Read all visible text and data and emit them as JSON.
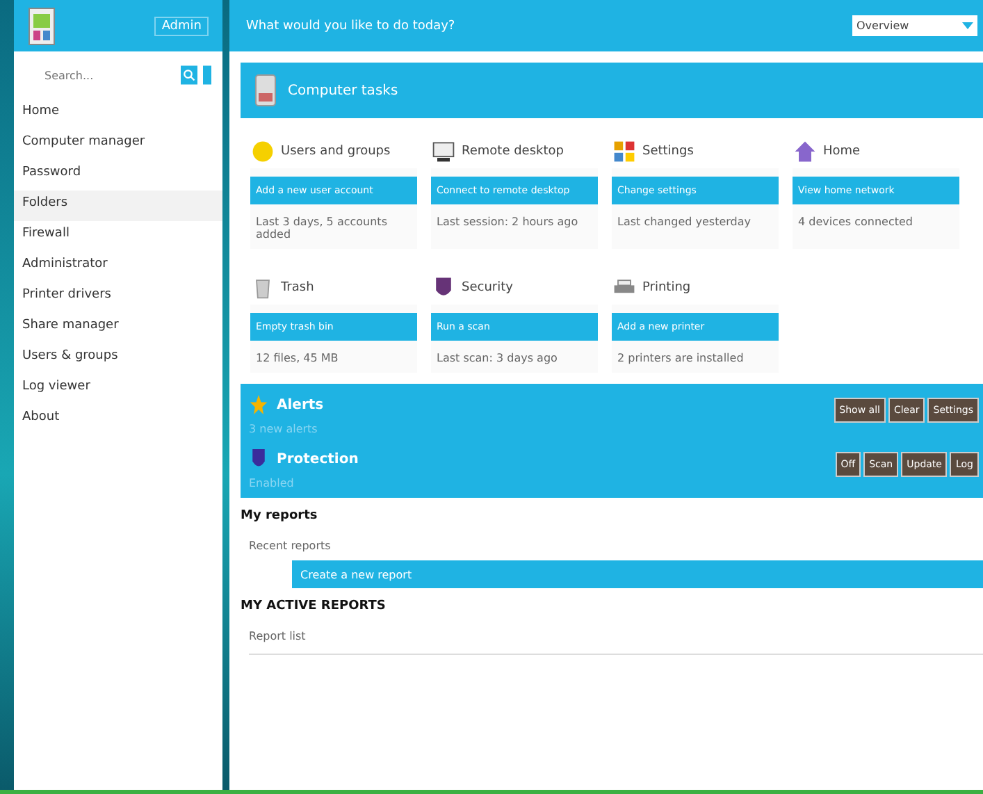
{
  "sidebar": {
    "brand": "Admin",
    "search": {
      "placeholder": "Search..."
    },
    "items": [
      {
        "label": "Home",
        "selected": false
      },
      {
        "label": "Computer manager",
        "selected": false
      },
      {
        "label": "Password",
        "selected": false
      },
      {
        "label": "Folders",
        "selected": true
      },
      {
        "label": "Firewall",
        "selected": false
      },
      {
        "label": "Administrator",
        "selected": false
      },
      {
        "label": "Printer drivers",
        "selected": false
      },
      {
        "label": "Share manager",
        "selected": false
      },
      {
        "label": "Users & groups",
        "selected": false
      },
      {
        "label": "Log viewer",
        "selected": false
      },
      {
        "label": "About",
        "selected": false
      }
    ]
  },
  "topbar": {
    "title": "What would you like to do today?",
    "select": "Overview"
  },
  "section": {
    "title": "Computer tasks"
  },
  "cards": [
    {
      "kind": "smiley",
      "title": "Users and groups",
      "action": "Add a new user account",
      "note": "Last 3 days, 5 accounts added"
    },
    {
      "kind": "monitor",
      "title": "Remote desktop",
      "action": "Connect to remote desktop",
      "note": "Last session: 2 hours ago"
    },
    {
      "kind": "blocks",
      "title": "Settings",
      "action": "Change settings",
      "note": "Last changed yesterday"
    },
    {
      "kind": "house",
      "title": "Home",
      "action": "View home network",
      "note": "4 devices connected"
    },
    {
      "kind": "bin",
      "title": "Trash",
      "action": "Empty trash bin",
      "note": "12 files, 45 MB"
    },
    {
      "kind": "shield",
      "title": "Security",
      "action": "Run a scan",
      "note": "Last scan: 3 days ago"
    },
    {
      "kind": "printer",
      "title": "Printing",
      "action": "Add a new printer",
      "note": "2 printers are installed"
    }
  ],
  "panel_rows": [
    {
      "kind": "star",
      "title": "Alerts",
      "subtitle": "3 new alerts",
      "buttons": [
        "Show all",
        "Clear",
        "Settings"
      ]
    },
    {
      "kind": "shield",
      "title": "Protection",
      "subtitle": "Enabled",
      "buttons": [
        "Off",
        "Scan",
        "Update",
        "Log"
      ]
    }
  ],
  "reports": {
    "title": "My reports",
    "label": "Recent reports",
    "bar": "Create a new report"
  },
  "active": {
    "title": "MY ACTIVE REPORTS",
    "label": "Report list"
  }
}
